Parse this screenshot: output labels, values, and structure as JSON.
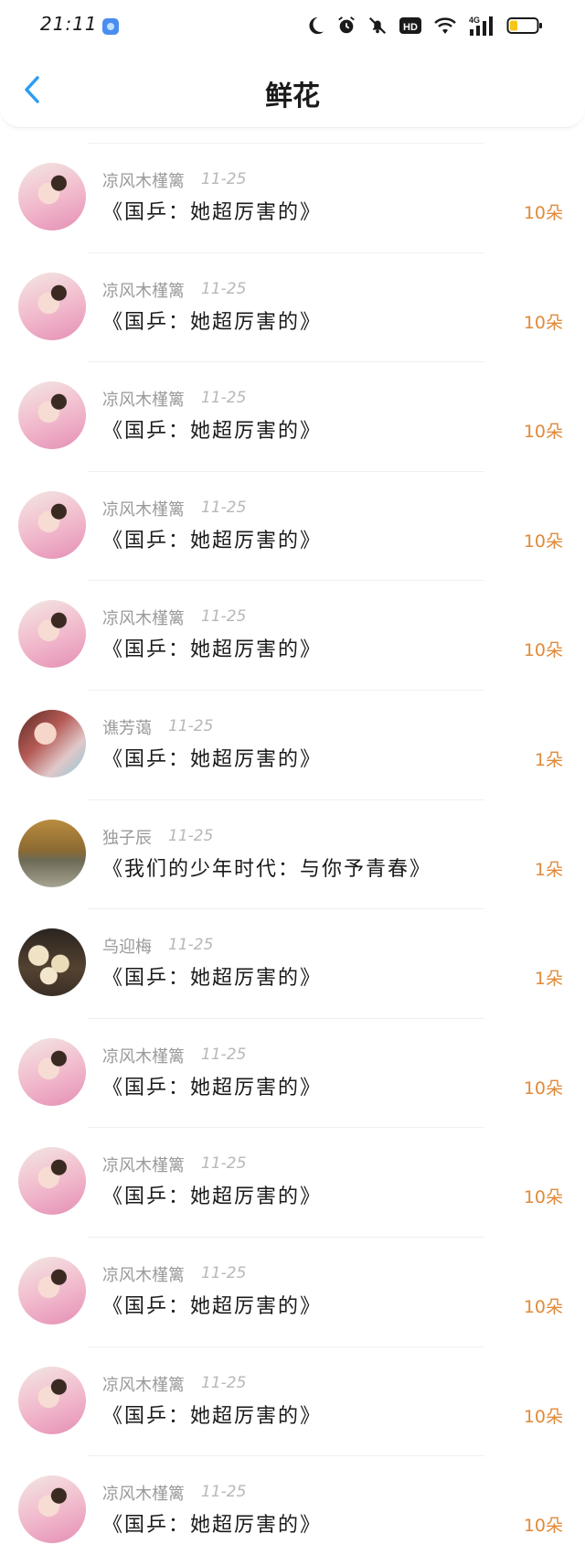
{
  "status_bar": {
    "time": "21:11",
    "indicator_hd": "HD",
    "indicator_network": "4G"
  },
  "header": {
    "title": "鲜花"
  },
  "colors": {
    "accent_blue": "#2a9df4",
    "count_orange": "#e08a3a",
    "meta_gray": "#9a9a9a"
  },
  "items": [
    {
      "username": "凉风木槿篱",
      "date": "11-25",
      "book": "《国乒：她超厉害的》",
      "count": "10朵",
      "avatar": "girl-illustration-avatar"
    },
    {
      "username": "凉风木槿篱",
      "date": "11-25",
      "book": "《国乒：她超厉害的》",
      "count": "10朵",
      "avatar": "girl-illustration-avatar"
    },
    {
      "username": "凉风木槿篱",
      "date": "11-25",
      "book": "《国乒：她超厉害的》",
      "count": "10朵",
      "avatar": "girl-illustration-avatar"
    },
    {
      "username": "凉风木槿篱",
      "date": "11-25",
      "book": "《国乒：她超厉害的》",
      "count": "10朵",
      "avatar": "girl-illustration-avatar"
    },
    {
      "username": "凉风木槿篱",
      "date": "11-25",
      "book": "《国乒：她超厉害的》",
      "count": "10朵",
      "avatar": "girl-illustration-avatar"
    },
    {
      "username": "谯芳蔼",
      "date": "11-25",
      "book": "《国乒：她超厉害的》",
      "count": "1朵",
      "avatar": "woman-photo-avatar"
    },
    {
      "username": "独子辰",
      "date": "11-25",
      "book": "《我们的少年时代：与你予青春》",
      "count": "1朵",
      "avatar": "sunset-photo-avatar"
    },
    {
      "username": "乌迎梅",
      "date": "11-25",
      "book": "《国乒：她超厉害的》",
      "count": "1朵",
      "avatar": "food-photo-avatar"
    },
    {
      "username": "凉风木槿篱",
      "date": "11-25",
      "book": "《国乒：她超厉害的》",
      "count": "10朵",
      "avatar": "girl-illustration-avatar"
    },
    {
      "username": "凉风木槿篱",
      "date": "11-25",
      "book": "《国乒：她超厉害的》",
      "count": "10朵",
      "avatar": "girl-illustration-avatar"
    },
    {
      "username": "凉风木槿篱",
      "date": "11-25",
      "book": "《国乒：她超厉害的》",
      "count": "10朵",
      "avatar": "girl-illustration-avatar"
    },
    {
      "username": "凉风木槿篱",
      "date": "11-25",
      "book": "《国乒：她超厉害的》",
      "count": "10朵",
      "avatar": "girl-illustration-avatar"
    },
    {
      "username": "凉风木槿篱",
      "date": "11-25",
      "book": "《国乒：她超厉害的》",
      "count": "10朵",
      "avatar": "girl-illustration-avatar"
    }
  ]
}
